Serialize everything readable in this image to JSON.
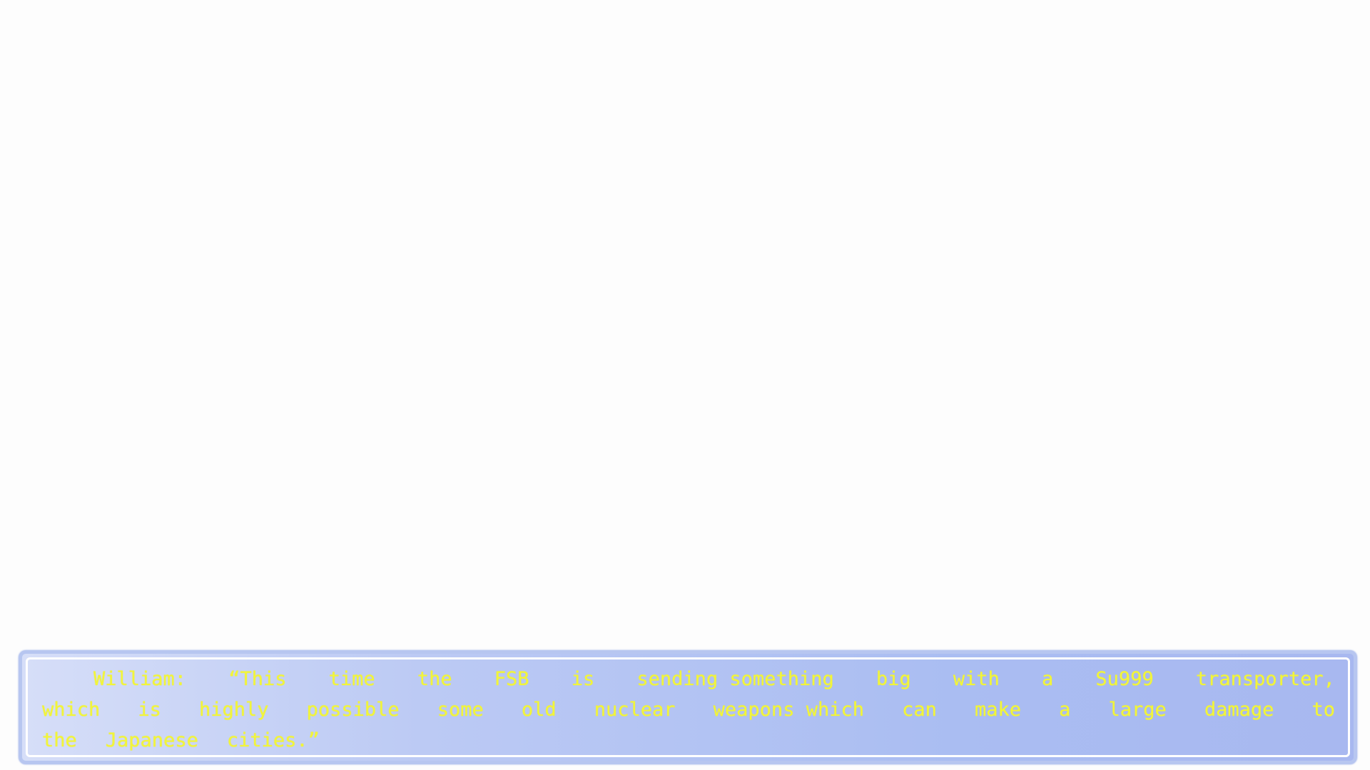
{
  "dialogue": {
    "speaker": "William:",
    "lines": [
      [
        "William:",
        "“This",
        "time",
        "the",
        "FSB",
        "is",
        "sending something",
        "big",
        "with",
        "a",
        "Su999",
        "transporter,"
      ],
      [
        "which",
        "is",
        "highly",
        "possible",
        "some",
        "old",
        "nuclear",
        "weapons which",
        "can",
        "make",
        "a",
        "large",
        "damage",
        "to"
      ],
      [
        "the",
        "Japanese",
        "cities.”"
      ]
    ],
    "text_color": "#f2f53a",
    "box_color": "#b7c6f0"
  }
}
